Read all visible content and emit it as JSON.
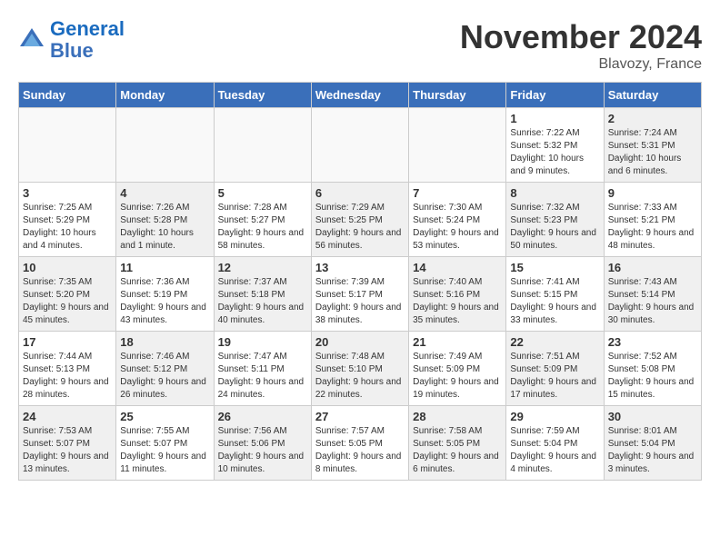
{
  "header": {
    "logo_line1": "General",
    "logo_line2": "Blue",
    "month": "November 2024",
    "location": "Blavozy, France"
  },
  "weekdays": [
    "Sunday",
    "Monday",
    "Tuesday",
    "Wednesday",
    "Thursday",
    "Friday",
    "Saturday"
  ],
  "weeks": [
    [
      {
        "day": "",
        "info": "",
        "shaded": false,
        "empty": true
      },
      {
        "day": "",
        "info": "",
        "shaded": false,
        "empty": true
      },
      {
        "day": "",
        "info": "",
        "shaded": false,
        "empty": true
      },
      {
        "day": "",
        "info": "",
        "shaded": false,
        "empty": true
      },
      {
        "day": "",
        "info": "",
        "shaded": false,
        "empty": true
      },
      {
        "day": "1",
        "info": "Sunrise: 7:22 AM\nSunset: 5:32 PM\nDaylight: 10 hours and 9 minutes.",
        "shaded": false,
        "empty": false
      },
      {
        "day": "2",
        "info": "Sunrise: 7:24 AM\nSunset: 5:31 PM\nDaylight: 10 hours and 6 minutes.",
        "shaded": true,
        "empty": false
      }
    ],
    [
      {
        "day": "3",
        "info": "Sunrise: 7:25 AM\nSunset: 5:29 PM\nDaylight: 10 hours and 4 minutes.",
        "shaded": false,
        "empty": false
      },
      {
        "day": "4",
        "info": "Sunrise: 7:26 AM\nSunset: 5:28 PM\nDaylight: 10 hours and 1 minute.",
        "shaded": true,
        "empty": false
      },
      {
        "day": "5",
        "info": "Sunrise: 7:28 AM\nSunset: 5:27 PM\nDaylight: 9 hours and 58 minutes.",
        "shaded": false,
        "empty": false
      },
      {
        "day": "6",
        "info": "Sunrise: 7:29 AM\nSunset: 5:25 PM\nDaylight: 9 hours and 56 minutes.",
        "shaded": true,
        "empty": false
      },
      {
        "day": "7",
        "info": "Sunrise: 7:30 AM\nSunset: 5:24 PM\nDaylight: 9 hours and 53 minutes.",
        "shaded": false,
        "empty": false
      },
      {
        "day": "8",
        "info": "Sunrise: 7:32 AM\nSunset: 5:23 PM\nDaylight: 9 hours and 50 minutes.",
        "shaded": true,
        "empty": false
      },
      {
        "day": "9",
        "info": "Sunrise: 7:33 AM\nSunset: 5:21 PM\nDaylight: 9 hours and 48 minutes.",
        "shaded": false,
        "empty": false
      }
    ],
    [
      {
        "day": "10",
        "info": "Sunrise: 7:35 AM\nSunset: 5:20 PM\nDaylight: 9 hours and 45 minutes.",
        "shaded": true,
        "empty": false
      },
      {
        "day": "11",
        "info": "Sunrise: 7:36 AM\nSunset: 5:19 PM\nDaylight: 9 hours and 43 minutes.",
        "shaded": false,
        "empty": false
      },
      {
        "day": "12",
        "info": "Sunrise: 7:37 AM\nSunset: 5:18 PM\nDaylight: 9 hours and 40 minutes.",
        "shaded": true,
        "empty": false
      },
      {
        "day": "13",
        "info": "Sunrise: 7:39 AM\nSunset: 5:17 PM\nDaylight: 9 hours and 38 minutes.",
        "shaded": false,
        "empty": false
      },
      {
        "day": "14",
        "info": "Sunrise: 7:40 AM\nSunset: 5:16 PM\nDaylight: 9 hours and 35 minutes.",
        "shaded": true,
        "empty": false
      },
      {
        "day": "15",
        "info": "Sunrise: 7:41 AM\nSunset: 5:15 PM\nDaylight: 9 hours and 33 minutes.",
        "shaded": false,
        "empty": false
      },
      {
        "day": "16",
        "info": "Sunrise: 7:43 AM\nSunset: 5:14 PM\nDaylight: 9 hours and 30 minutes.",
        "shaded": true,
        "empty": false
      }
    ],
    [
      {
        "day": "17",
        "info": "Sunrise: 7:44 AM\nSunset: 5:13 PM\nDaylight: 9 hours and 28 minutes.",
        "shaded": false,
        "empty": false
      },
      {
        "day": "18",
        "info": "Sunrise: 7:46 AM\nSunset: 5:12 PM\nDaylight: 9 hours and 26 minutes.",
        "shaded": true,
        "empty": false
      },
      {
        "day": "19",
        "info": "Sunrise: 7:47 AM\nSunset: 5:11 PM\nDaylight: 9 hours and 24 minutes.",
        "shaded": false,
        "empty": false
      },
      {
        "day": "20",
        "info": "Sunrise: 7:48 AM\nSunset: 5:10 PM\nDaylight: 9 hours and 22 minutes.",
        "shaded": true,
        "empty": false
      },
      {
        "day": "21",
        "info": "Sunrise: 7:49 AM\nSunset: 5:09 PM\nDaylight: 9 hours and 19 minutes.",
        "shaded": false,
        "empty": false
      },
      {
        "day": "22",
        "info": "Sunrise: 7:51 AM\nSunset: 5:09 PM\nDaylight: 9 hours and 17 minutes.",
        "shaded": true,
        "empty": false
      },
      {
        "day": "23",
        "info": "Sunrise: 7:52 AM\nSunset: 5:08 PM\nDaylight: 9 hours and 15 minutes.",
        "shaded": false,
        "empty": false
      }
    ],
    [
      {
        "day": "24",
        "info": "Sunrise: 7:53 AM\nSunset: 5:07 PM\nDaylight: 9 hours and 13 minutes.",
        "shaded": true,
        "empty": false
      },
      {
        "day": "25",
        "info": "Sunrise: 7:55 AM\nSunset: 5:07 PM\nDaylight: 9 hours and 11 minutes.",
        "shaded": false,
        "empty": false
      },
      {
        "day": "26",
        "info": "Sunrise: 7:56 AM\nSunset: 5:06 PM\nDaylight: 9 hours and 10 minutes.",
        "shaded": true,
        "empty": false
      },
      {
        "day": "27",
        "info": "Sunrise: 7:57 AM\nSunset: 5:05 PM\nDaylight: 9 hours and 8 minutes.",
        "shaded": false,
        "empty": false
      },
      {
        "day": "28",
        "info": "Sunrise: 7:58 AM\nSunset: 5:05 PM\nDaylight: 9 hours and 6 minutes.",
        "shaded": true,
        "empty": false
      },
      {
        "day": "29",
        "info": "Sunrise: 7:59 AM\nSunset: 5:04 PM\nDaylight: 9 hours and 4 minutes.",
        "shaded": false,
        "empty": false
      },
      {
        "day": "30",
        "info": "Sunrise: 8:01 AM\nSunset: 5:04 PM\nDaylight: 9 hours and 3 minutes.",
        "shaded": true,
        "empty": false
      }
    ]
  ]
}
